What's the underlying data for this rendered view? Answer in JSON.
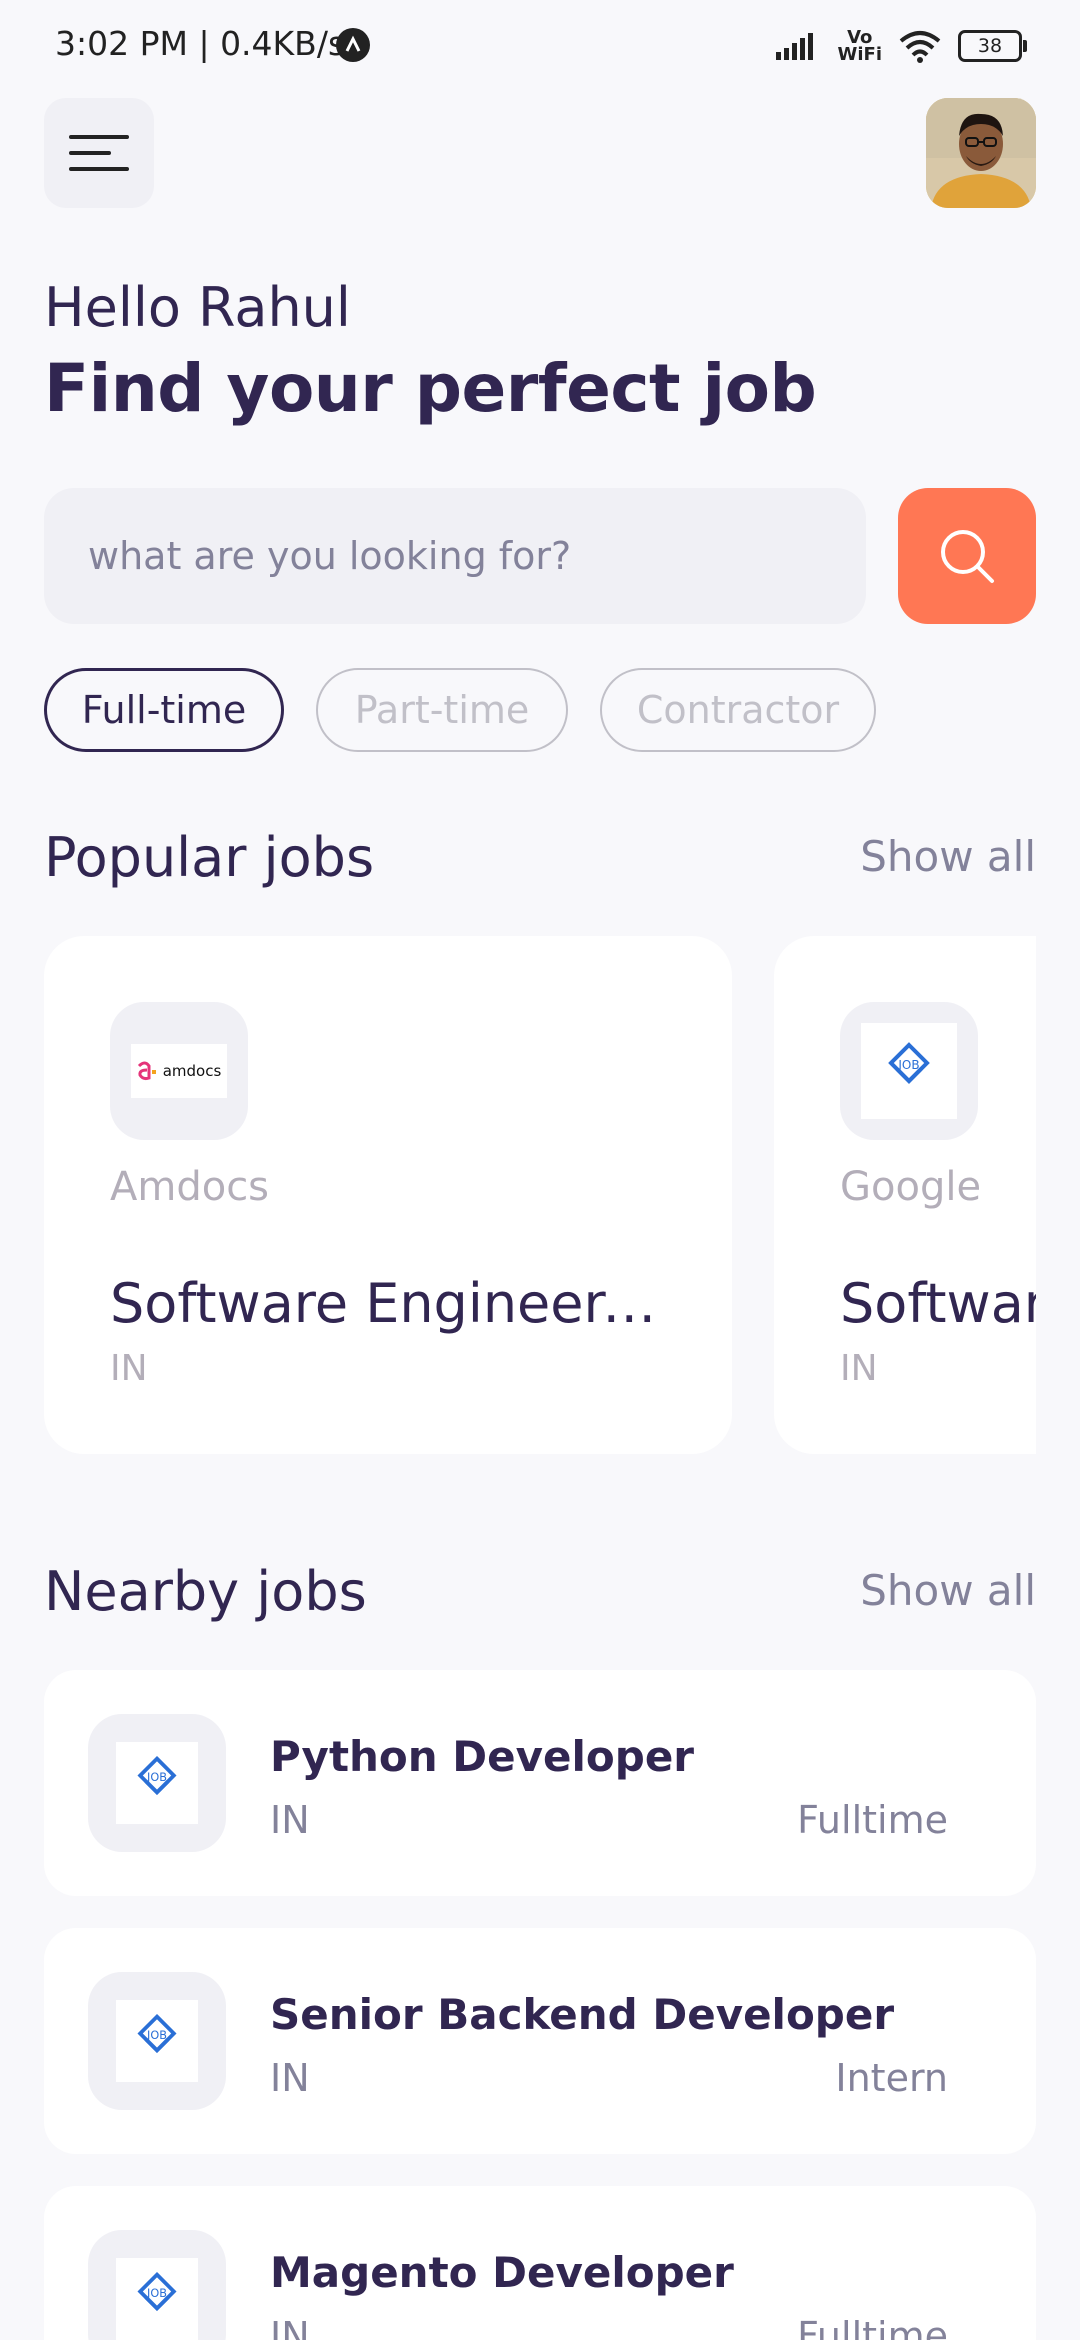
{
  "status_bar": {
    "time": "3:02 PM | 0.4KB/s",
    "vowifi_top": "Vo",
    "vowifi_bottom": "WiFi",
    "battery": "38"
  },
  "header": {
    "menu_icon": "menu-icon",
    "avatar_alt": "profile avatar"
  },
  "welcome": {
    "greeting": "Hello Rahul",
    "headline": "Find your perfect job"
  },
  "search": {
    "placeholder": "what are you looking for?",
    "value": "",
    "button_icon": "search-icon"
  },
  "job_types": [
    "Full-time",
    "Part-time",
    "Contractor"
  ],
  "popular": {
    "title": "Popular jobs",
    "show_all": "Show all",
    "cards": [
      {
        "company": "Amdocs",
        "title": "Software Engineer-...",
        "location": "IN",
        "logo_text": "amdocs"
      },
      {
        "company": "Google",
        "title": "Softwar",
        "location": "IN",
        "logo_text": "JOB"
      }
    ]
  },
  "nearby": {
    "title": "Nearby jobs",
    "show_all": "Show all",
    "jobs": [
      {
        "title": "Python Developer",
        "location": "IN",
        "type": "Fulltime",
        "logo_text": "JOB"
      },
      {
        "title": "Senior Backend Developer",
        "location": "IN",
        "type": "Intern",
        "logo_text": "JOB"
      },
      {
        "title": "Magento Developer",
        "location": "IN",
        "type": "Fulltime",
        "logo_text": "JOB"
      }
    ]
  },
  "colors": {
    "primary": "#312651",
    "accent": "#ff7754",
    "gray": "#83829a",
    "background": "#f8f8fb"
  }
}
